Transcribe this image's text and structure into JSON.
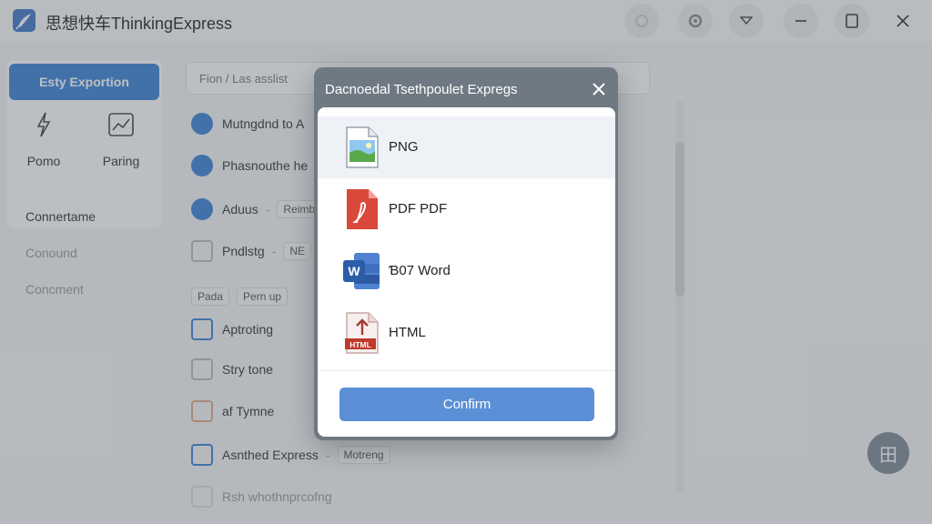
{
  "window": {
    "title": "思想快车ThinkingExpress"
  },
  "background": {
    "primary_button": "Esty Exportion",
    "tools": [
      "Pomo",
      "Paring"
    ],
    "section_head": "Connertame",
    "section_items": [
      "Conound",
      "Concment"
    ],
    "search_placeholder": "Fion / Las asslist",
    "rows": [
      {
        "label": "Mutngdnd to A",
        "chip": ""
      },
      {
        "label": "Phasnouthe he",
        "chip": ""
      },
      {
        "label": "Aduus",
        "chip": "Reimb"
      },
      {
        "label": "Pndlstg",
        "chip": "NE"
      },
      {
        "label": "Aptroting",
        "chip": ""
      },
      {
        "label": "Stry tone",
        "chip": ""
      },
      {
        "label": "af Tymne",
        "chip": ""
      },
      {
        "label": "Asnthed Express",
        "chip": "Motreng"
      },
      {
        "label": "Rsh whothnprcofng",
        "chip": ""
      }
    ],
    "tag_chips": [
      "Pada",
      "Pern up"
    ],
    "float_button_glyph": "田"
  },
  "dialog": {
    "title": "Dacnoedal Tsethpoulet Expregs",
    "options": [
      {
        "label": "PNG",
        "icon": "png-file-icon",
        "selected": true
      },
      {
        "label": "PDF PDF",
        "icon": "pdf-file-icon",
        "selected": false
      },
      {
        "label": "Ɓ07 Word",
        "icon": "word-file-icon",
        "selected": false
      },
      {
        "label": "HTML",
        "icon": "html-file-icon",
        "selected": false
      }
    ],
    "confirm_label": "Confirm",
    "colors": {
      "accent": "#5b8fd6",
      "selected_row": "#eef1f5",
      "pdf_red": "#d9483b",
      "word_blue": "#2b5ca8"
    }
  }
}
